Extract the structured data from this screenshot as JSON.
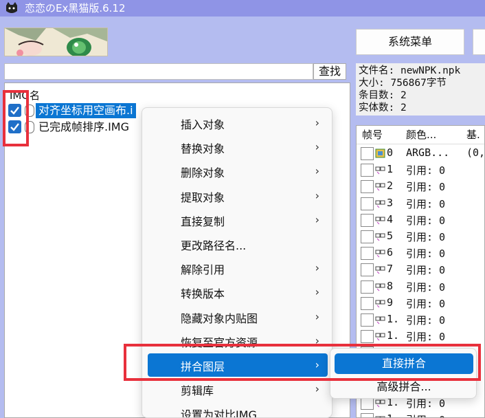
{
  "window": {
    "title": "恋恋のEx黑猫版.6.12"
  },
  "toolbar": {
    "search_label": "查找",
    "system_menu_label": "系统菜单",
    "search_value": ""
  },
  "file_info": {
    "lines": [
      "文件名: newNPK.npk",
      "大小: 756867字节",
      "条目数: 2",
      "实体数: 2"
    ]
  },
  "img_list": {
    "header": "IMG名",
    "items": [
      {
        "name": "对齐坐标用空画布.i",
        "checked": true,
        "selected": true
      },
      {
        "name": "已完成帧排序.IMG",
        "checked": true,
        "selected": false
      }
    ]
  },
  "frame_list": {
    "columns": [
      "帧号",
      "颜色...",
      "基."
    ],
    "rows": [
      {
        "idx": "0",
        "value": "ARGB...",
        "extra": "(0,"
      },
      {
        "idx": "1",
        "value": "引用: 0"
      },
      {
        "idx": "2",
        "value": "引用: 0"
      },
      {
        "idx": "3",
        "value": "引用: 0"
      },
      {
        "idx": "4",
        "value": "引用: 0"
      },
      {
        "idx": "5",
        "value": "引用: 0"
      },
      {
        "idx": "6",
        "value": "引用: 0"
      },
      {
        "idx": "7",
        "value": "引用: 0"
      },
      {
        "idx": "8",
        "value": "引用: 0"
      },
      {
        "idx": "9",
        "value": "引用: 0"
      },
      {
        "idx": "1.",
        "value": "引用: 0"
      },
      {
        "idx": "1.",
        "value": "引用: 0"
      },
      {
        "idx": "1.",
        "value": "引用: 0"
      },
      {
        "idx": "1.",
        "value": "引用: 0"
      },
      {
        "idx": "1.",
        "value": "引用: 0"
      },
      {
        "idx": "1.",
        "value": "引用: 0"
      },
      {
        "idx": "1.",
        "value": "引用: 0"
      }
    ]
  },
  "context_menu": {
    "items": [
      {
        "label": "插入对象",
        "submenu": true,
        "highlighted": false
      },
      {
        "label": "替换对象",
        "submenu": true,
        "highlighted": false
      },
      {
        "label": "删除对象",
        "submenu": true,
        "highlighted": false
      },
      {
        "label": "提取对象",
        "submenu": true,
        "highlighted": false
      },
      {
        "label": "直接复制",
        "submenu": true,
        "highlighted": false
      },
      {
        "label": "更改路径名...",
        "submenu": false,
        "highlighted": false
      },
      {
        "label": "解除引用",
        "submenu": true,
        "highlighted": false
      },
      {
        "label": "转换版本",
        "submenu": true,
        "highlighted": false
      },
      {
        "label": "隐藏对象内贴图",
        "submenu": true,
        "highlighted": false
      },
      {
        "label": "恢复至官方资源",
        "submenu": true,
        "highlighted": false
      },
      {
        "label": "拼合图层",
        "submenu": true,
        "highlighted": true
      },
      {
        "label": "剪辑库",
        "submenu": true,
        "highlighted": false
      },
      {
        "label": "设置为对比IMG",
        "submenu": false,
        "highlighted": false
      }
    ],
    "arrow_glyph": "›"
  },
  "submenu": {
    "items": [
      {
        "label": "直接拼合",
        "highlighted": true
      },
      {
        "label": "高级拼合...",
        "highlighted": false
      }
    ]
  },
  "colors": {
    "accent": "#0b76d3",
    "annotation_red": "#e8303c",
    "titlebar": "#8f94e6",
    "background": "#b4bcf0"
  },
  "icons": {
    "app": "cat-icon",
    "checkbox": "checkmark-icon",
    "frame": "frame-icon",
    "submenu_arrow": "chevron-right-icon"
  }
}
